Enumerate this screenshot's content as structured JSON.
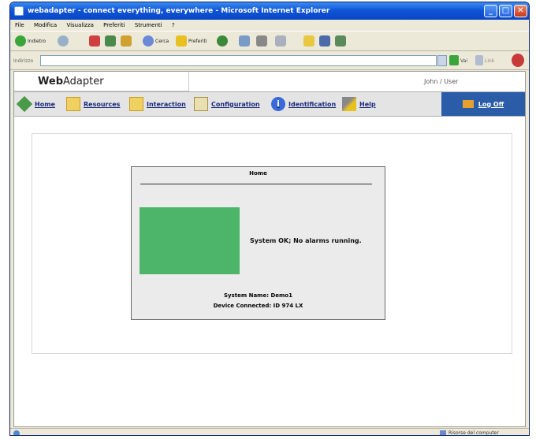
{
  "window": {
    "title": "webadapter - connect everything, everywhere - Microsoft Internet Explorer",
    "controls": {
      "minimize": "_",
      "maximize": "□",
      "close": "✕"
    }
  },
  "menubar": [
    "File",
    "Modifica",
    "Visualizza",
    "Preferiti",
    "Strumenti",
    "?"
  ],
  "toolbar": {
    "back_label": "Indietro",
    "search_label": "Cerca",
    "favorites_label": "Preferiti"
  },
  "addressbar": {
    "label": "Indirizzo",
    "go_label": "Vai",
    "links_label": "Link"
  },
  "app": {
    "brand_bold": "Web",
    "brand_rest": "Adapter",
    "user": "John / User",
    "nav": [
      {
        "label": "Home",
        "icon": "home-icon"
      },
      {
        "label": "Resources",
        "icon": "folder-icon"
      },
      {
        "label": "Interaction",
        "icon": "folder-icon"
      },
      {
        "label": "Configuration",
        "icon": "config-icon"
      },
      {
        "label": "Identification",
        "icon": "info-icon"
      },
      {
        "label": "Help",
        "icon": "wand-icon"
      }
    ],
    "logoff": "Log Off"
  },
  "home_card": {
    "title": "Home",
    "status_color": "#4cb56a",
    "status_text": "System OK; No alarms running.",
    "system_name": "System Name: Demo1",
    "device": "Device Connected: ID 974 LX"
  },
  "statusbar": {
    "zone": "Risorse del computer"
  }
}
